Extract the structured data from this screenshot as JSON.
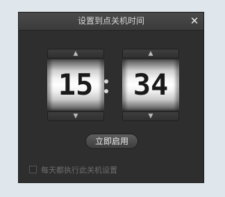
{
  "window": {
    "title": "设置到点关机时间",
    "close_glyph": "✕"
  },
  "time": {
    "hours": "15",
    "minutes": "34",
    "up_glyph": "▲",
    "down_glyph": "▼"
  },
  "actions": {
    "start_label": "立即启用"
  },
  "options": {
    "daily_label": "每天都执行此关机设置",
    "daily_checked": false
  }
}
